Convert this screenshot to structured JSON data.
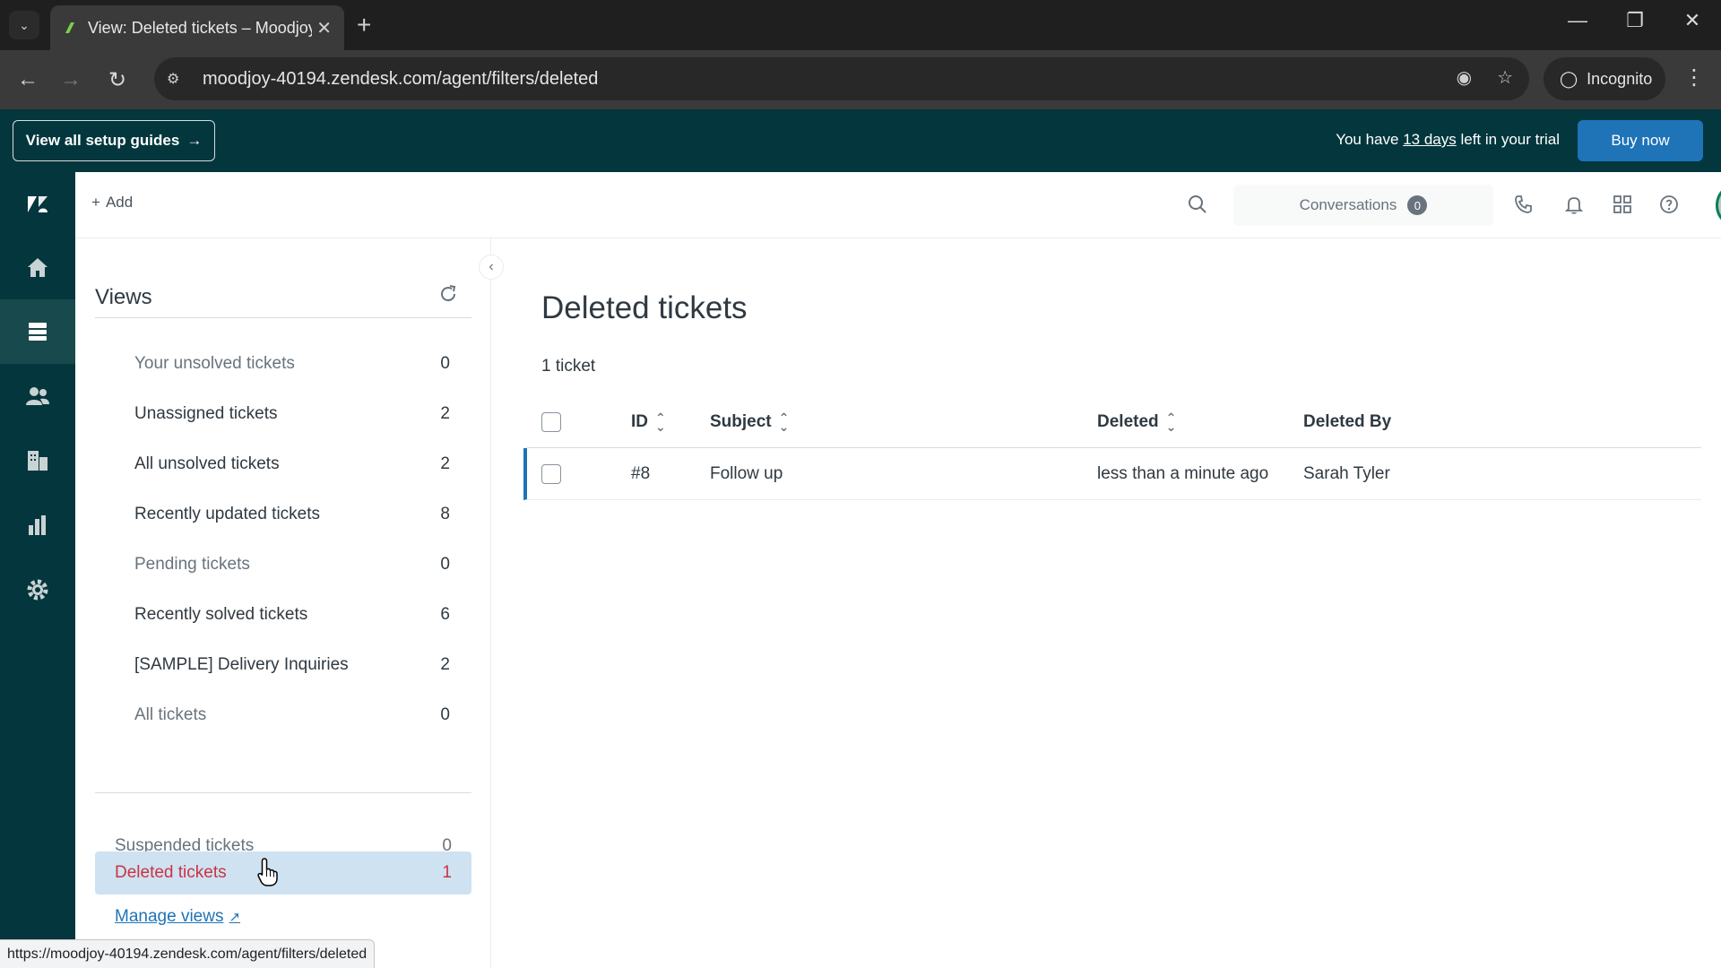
{
  "browser": {
    "tab_title": "View: Deleted tickets – Moodjoy",
    "url": "moodjoy-40194.zendesk.com/agent/filters/deleted",
    "incognito_label": "Incognito",
    "status_url": "https://moodjoy-40194.zendesk.com/agent/filters/deleted"
  },
  "banner": {
    "setup_guides_label": "View all setup guides",
    "trial_prefix": "You have ",
    "trial_days": "13 days",
    "trial_suffix": " left in your trial",
    "buy_label": "Buy now"
  },
  "topbar": {
    "add_label": "Add",
    "conversations_label": "Conversations",
    "conversations_count": "0"
  },
  "views": {
    "title": "Views",
    "items": [
      {
        "label": "Your unsolved tickets",
        "count": "0",
        "muted": true
      },
      {
        "label": "Unassigned tickets",
        "count": "2",
        "muted": false
      },
      {
        "label": "All unsolved tickets",
        "count": "2",
        "muted": false
      },
      {
        "label": "Recently updated tickets",
        "count": "8",
        "muted": false
      },
      {
        "label": "Pending tickets",
        "count": "0",
        "muted": true
      },
      {
        "label": "Recently solved tickets",
        "count": "6",
        "muted": false
      },
      {
        "label": "[SAMPLE] Delivery Inquiries",
        "count": "2",
        "muted": false
      },
      {
        "label": "All tickets",
        "count": "0",
        "muted": true
      }
    ],
    "suspended": {
      "label": "Suspended tickets",
      "count": "0"
    },
    "deleted": {
      "label": "Deleted tickets",
      "count": "1"
    },
    "manage_label": "Manage views"
  },
  "main": {
    "title": "Deleted tickets",
    "count_text": "1 ticket",
    "columns": {
      "id": "ID",
      "subject": "Subject",
      "deleted": "Deleted",
      "deleted_by": "Deleted By"
    },
    "rows": [
      {
        "id": "#8",
        "subject": "Follow up",
        "deleted": "less than a minute ago",
        "deleted_by": "Sarah Tyler"
      }
    ]
  },
  "colors": {
    "brand_dark": "#03363d",
    "primary_blue": "#1f73b7",
    "selected_bg": "#cee2f2",
    "selected_text": "#cc3340",
    "online_green": "#038153"
  }
}
